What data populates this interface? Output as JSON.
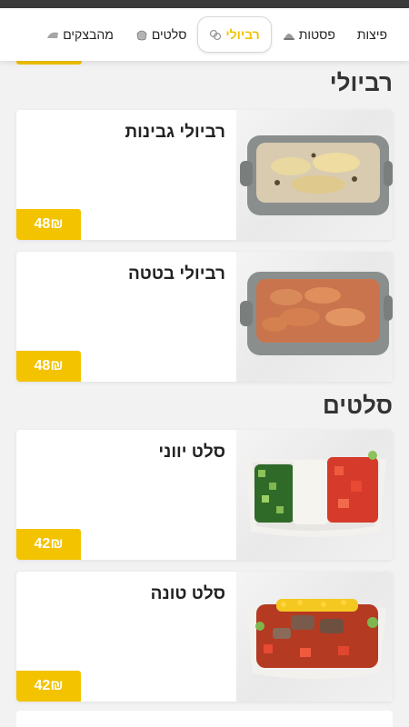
{
  "tabs": [
    {
      "label": "פיצות",
      "icon": "none"
    },
    {
      "label": "פסטות",
      "icon": "pasta-icon"
    },
    {
      "label": "רביולי",
      "icon": "ravioli-icon",
      "active": true
    },
    {
      "label": "סלטים",
      "icon": "salad-icon"
    },
    {
      "label": "מהבצקים",
      "icon": "dough-icon"
    }
  ],
  "sections": [
    {
      "title": "רביולי",
      "items": [
        {
          "name": "רביולי גבינות",
          "price": "48₪",
          "image": "cheese-ravioli-dish"
        },
        {
          "name": "רביולי בטטה",
          "price": "48₪",
          "image": "sweet-potato-ravioli-dish"
        }
      ]
    },
    {
      "title": "סלטים",
      "items": [
        {
          "name": "סלט יווני",
          "price": "42₪",
          "image": "greek-salad-dish"
        },
        {
          "name": "סלט טונה",
          "price": "42₪",
          "image": "tuna-salad-dish"
        }
      ]
    }
  ],
  "colors": {
    "accent": "#f3c300",
    "background": "#f2f2f2",
    "card": "#ffffff"
  }
}
